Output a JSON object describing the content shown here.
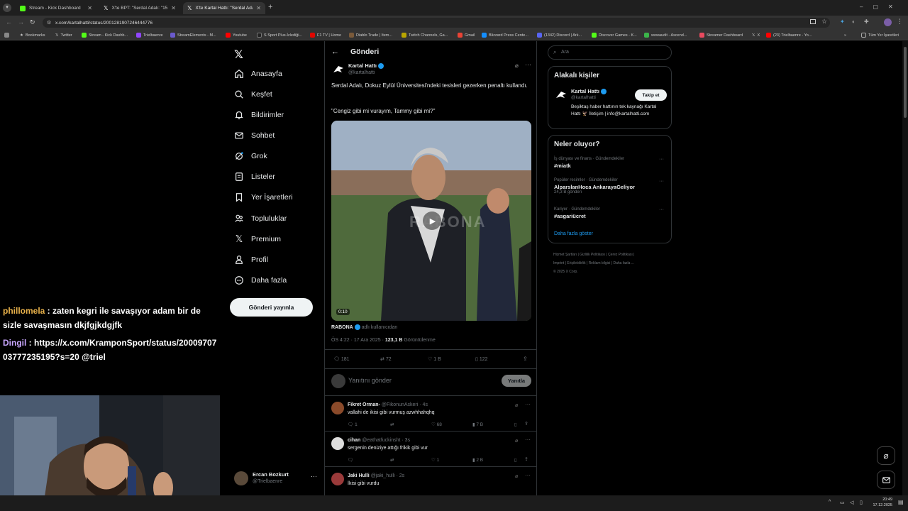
{
  "browser": {
    "tabs": [
      {
        "title": "Stream - Kick Dashboard"
      },
      {
        "title": "X'te BPT: \"Serdal Adalı: \"15.000"
      },
      {
        "title": "X'te Kartal Hattı: \"Serdal Adalı, D"
      }
    ],
    "url": "x.com/kartalhatti/status/2001281907246444776",
    "bookmarks": [
      "Bookmarks",
      "Twitter",
      "Stream - Kick Dashb...",
      "Trielbaenre",
      "StreamElements - M...",
      "Youtube",
      "S Sport Plus-İzlediği...",
      "F1 TV | Home",
      "Diablo Trade | Item...",
      "Twitch Channels, Ga...",
      "Gmail",
      "Blizzard Press Cente...",
      "(1342) Discord | Ark...",
      "Discover Games - K...",
      "wowaudit - Ascend...",
      "Streamer Dashboard",
      "X",
      "(23) Trielbaenre - Yo..."
    ],
    "bookmarks_right": "Tüm Yer İşaretleri"
  },
  "chat": [
    {
      "user": "phillomela",
      "color": "#e8b14a",
      "text": " : zaten kegri ile savaşıyor adam bir de sizle savaşmasın dkjfgjkdgjfk"
    },
    {
      "user": "Dingil",
      "color": "#c9a7ff",
      "text": " : https://x.com/KramponSport/status/2000970703777235195?s=20 @triel"
    }
  ],
  "nav": {
    "items": [
      "Anasayfa",
      "Keşfet",
      "Bildirimler",
      "Sohbet",
      "Grok",
      "Listeler",
      "Yer İşaretleri",
      "Topluluklar",
      "Premium",
      "Profil",
      "Daha fazla"
    ],
    "post_button": "Gönderi yayınla",
    "account": {
      "name": "Ercan Bozkurt",
      "handle": "@Trielbaenre"
    }
  },
  "post": {
    "header": "Gönderi",
    "author": "Kartal Hattı",
    "handle": "@kartalhatti",
    "text1": "Serdal Adalı, Dokuz Eylül Üniversitesi'ndeki tesisleri gezerken penaltı kullandı.",
    "text2": "\"Cengiz gibi mi vurayım, Tammy gibi mi?\"",
    "video_time": "0:10",
    "video_watermark": "RABONA",
    "source_name": "RABONA",
    "source_suffix": "adlı kullanıcıdan",
    "time": "ÖS 4:22 · 17 Ara 2025 · ",
    "views": "123,1 B",
    "views_label": "Görüntülenme",
    "stats": {
      "replies": "181",
      "reposts": "72",
      "likes": "1 B",
      "bookmarks": "122"
    },
    "reply_placeholder": "Yanıtını gönder",
    "reply_button": "Yanıtla"
  },
  "replies": [
    {
      "name": "Fikret Orman-",
      "handle": "@FikonunAskeri",
      "age": "· 4s",
      "text": "vallahi de ikisi gibi vurmuş azwhhahqhq",
      "replies": "1",
      "likes": "68",
      "views": "7 B"
    },
    {
      "name": "cihan",
      "handle": "@eathatfuckinsht",
      "age": "· 3s",
      "text": "sergenin deniziye attığı frikik gibi vur",
      "replies": "",
      "likes": "1",
      "views": "2 B"
    },
    {
      "name": "Jaki Hulli",
      "handle": "@jaki_hulli",
      "age": "· 2s",
      "text": "İkisi gibi vurdu",
      "replies": "",
      "likes": "",
      "views": ""
    }
  ],
  "sidebar": {
    "search_placeholder": "Ara",
    "related_title": "Alakalı kişiler",
    "related": {
      "name": "Kartal Hattı",
      "handle": "@kartalhatti",
      "follow": "Takip et",
      "bio": "Beşiktaş haber hattının tek kaynağı Kartal Hattı 🦅 İletişim | info@kartalhatti.com"
    },
    "trending_title": "Neler oluyor?",
    "trends": [
      {
        "context": "İş dünyası ve finans · Gündemdekiler",
        "name": "#miatk",
        "count": ""
      },
      {
        "context": "Popüler resimler · Gündemdekiler",
        "name": "AlparslanHoca AnkarayaGeliyor",
        "count": "24,3 B gönderi"
      },
      {
        "context": "Kariyer · Gündemdekiler",
        "name": "#asgariücret",
        "count": ""
      }
    ],
    "show_more": "Daha fazla göster",
    "footer": [
      "Hizmet Şartları",
      "Gizlilik Politikası",
      "Çerez Politikası",
      "Imprint",
      "Erişilebilirlik",
      "Reklam bilgisi",
      "Daha fazla ...",
      "© 2025 X Corp."
    ]
  },
  "taskbar": {
    "time": "20:49",
    "date": "17.12.2025"
  }
}
